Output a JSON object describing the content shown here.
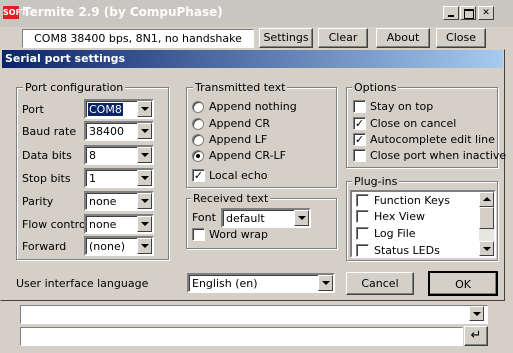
{
  "main": {
    "title": "Termite 2.9 (by CompuPhase)",
    "logo_text": "SOFT",
    "status": "COM8 38400 bps, 8N1, no handshake",
    "buttons": [
      "Settings",
      "Clear",
      "About",
      "Close"
    ],
    "enter_glyph": "↵"
  },
  "dialog": {
    "title": "Serial port settings",
    "port_config": {
      "label": "Port configuration",
      "rows": [
        {
          "label": "Port",
          "value": "COM8"
        },
        {
          "label": "Baud rate",
          "value": "38400"
        },
        {
          "label": "Data bits",
          "value": "8"
        },
        {
          "label": "Stop bits",
          "value": "1"
        },
        {
          "label": "Parity",
          "value": "none"
        },
        {
          "label": "Flow control",
          "value": "none"
        },
        {
          "label": "Forward",
          "value": "(none)"
        }
      ]
    },
    "transmitted": {
      "label": "Transmitted text",
      "options": [
        "Append nothing",
        "Append CR",
        "Append LF",
        "Append CR-LF"
      ],
      "selected_index": 3,
      "local_echo": {
        "label": "Local echo",
        "checked": true
      }
    },
    "received": {
      "label": "Received text",
      "font_label": "Font",
      "font_value": "default",
      "word_wrap": {
        "label": "Word wrap",
        "checked": false
      }
    },
    "options": {
      "label": "Options",
      "items": [
        {
          "label": "Stay on top",
          "checked": false
        },
        {
          "label": "Close on cancel",
          "checked": true
        },
        {
          "label": "Autocomplete edit line",
          "checked": true
        },
        {
          "label": "Close port when inactive",
          "checked": false
        }
      ]
    },
    "plugins": {
      "label": "Plug-ins",
      "items": [
        {
          "label": "Function Keys",
          "checked": false
        },
        {
          "label": "Hex View",
          "checked": false
        },
        {
          "label": "Log File",
          "checked": false
        },
        {
          "label": "Status LEDs",
          "checked": false
        }
      ]
    },
    "language": {
      "label": "User interface language",
      "value": "English (en)"
    },
    "cancel_label": "Cancel",
    "ok_label": "OK"
  },
  "check_glyph": "✓",
  "close_glyph": "✕"
}
